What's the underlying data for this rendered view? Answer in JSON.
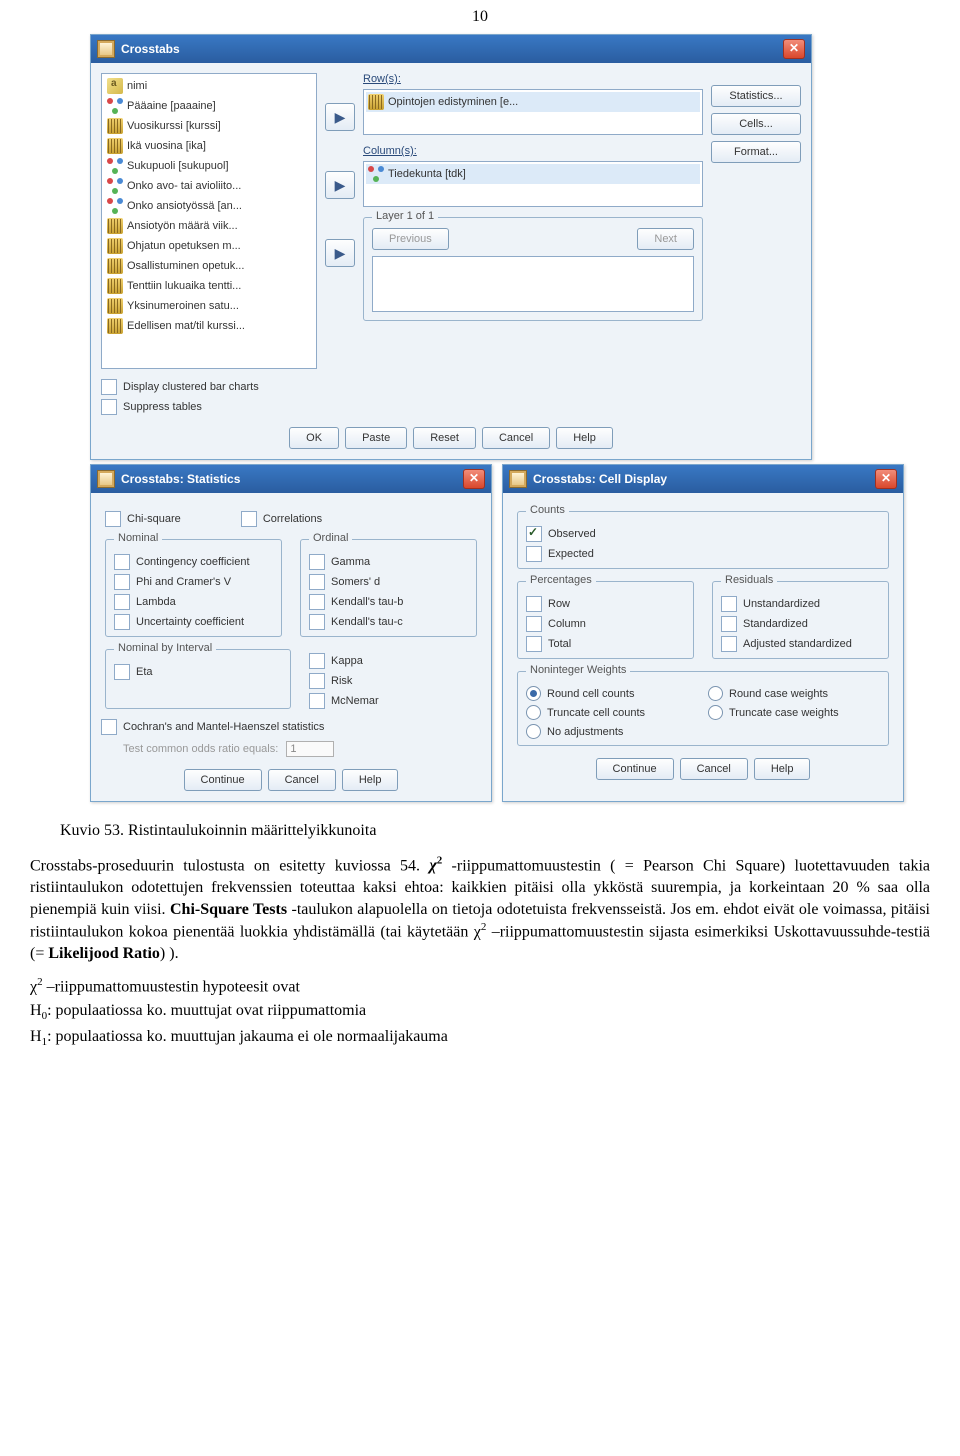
{
  "page_number": "10",
  "crosstabs": {
    "title": "Crosstabs",
    "vars": [
      {
        "icon": "str",
        "label": "nimi"
      },
      {
        "icon": "nom",
        "label": "Pääaine [paaaine]"
      },
      {
        "icon": "sca",
        "label": "Vuosikurssi [kurssi]"
      },
      {
        "icon": "sca",
        "label": "Ikä vuosina [ika]"
      },
      {
        "icon": "nom",
        "label": "Sukupuoli [sukupuol]"
      },
      {
        "icon": "nom",
        "label": "Onko avo- tai avioliito..."
      },
      {
        "icon": "nom",
        "label": "Onko ansiotyössä [an..."
      },
      {
        "icon": "sca",
        "label": "Ansiotyön määrä viik..."
      },
      {
        "icon": "sca",
        "label": "Ohjatun opetuksen m..."
      },
      {
        "icon": "sca",
        "label": "Osallistuminen opetuk..."
      },
      {
        "icon": "sca",
        "label": "Tenttiin lukuaika tentti..."
      },
      {
        "icon": "sca",
        "label": "Yksinumeroinen satu..."
      },
      {
        "icon": "sca",
        "label": "Edellisen mat/til kurssi..."
      }
    ],
    "rows_label": "Row(s):",
    "row_item": "Opintojen edistyminen [e...",
    "cols_label": "Column(s):",
    "col_item": "Tiedekunta [tdk]",
    "layer_label": "Layer 1 of 1",
    "previous": "Previous",
    "next": "Next",
    "statistics_btn": "Statistics...",
    "cells_btn": "Cells...",
    "format_btn": "Format...",
    "display_bar": "Display clustered bar charts",
    "suppress": "Suppress tables",
    "btns": {
      "ok": "OK",
      "paste": "Paste",
      "reset": "Reset",
      "cancel": "Cancel",
      "help": "Help"
    }
  },
  "stats": {
    "title": "Crosstabs: Statistics",
    "chi": "Chi-square",
    "corr": "Correlations",
    "nominal": {
      "label": "Nominal",
      "items": [
        "Contingency coefficient",
        "Phi and Cramer's V",
        "Lambda",
        "Uncertainty coefficient"
      ]
    },
    "ordinal": {
      "label": "Ordinal",
      "items": [
        "Gamma",
        "Somers' d",
        "Kendall's tau-b",
        "Kendall's tau-c"
      ]
    },
    "nom_int": {
      "label": "Nominal by Interval",
      "items": [
        "Eta"
      ]
    },
    "right": {
      "items": [
        "Kappa",
        "Risk",
        "McNemar"
      ]
    },
    "cochran": "Cochran's and Mantel-Haenszel statistics",
    "test_common": "Test common odds ratio equals:",
    "val": "1",
    "btns": {
      "cont": "Continue",
      "cancel": "Cancel",
      "help": "Help"
    }
  },
  "cells": {
    "title": "Crosstabs: Cell Display",
    "counts": {
      "label": "Counts",
      "observed": "Observed",
      "expected": "Expected"
    },
    "perc": {
      "label": "Percentages",
      "row": "Row",
      "col": "Column",
      "total": "Total"
    },
    "resid": {
      "label": "Residuals",
      "un": "Unstandardized",
      "st": "Standardized",
      "adj": "Adjusted standardized"
    },
    "nonint": {
      "label": "Noninteger Weights",
      "r": [
        "Round cell counts",
        "Truncate cell counts",
        "No adjustments"
      ],
      "r2": [
        "Round case weights",
        "Truncate case weights"
      ]
    },
    "btns": {
      "cont": "Continue",
      "cancel": "Cancel",
      "help": "Help"
    }
  },
  "caption": "Kuvio 53. Ristintaulukoinnin määrittelyikkunoita",
  "text": {
    "p1a": "Crosstabs-proseduurin tulostusta on esitetty kuviossa 54. ",
    "p1b": "-riippumattomuustestin ( = Pearson Chi Square) luotettavuuden takia ristiintaulukon odotettujen frekvenssien toteuttaa kaksi ehtoa: kaikkien pitäisi olla ykköstä suurempia, ja korkeintaan 20 % saa olla pienempiä kuin viisi. ",
    "p1c": "Chi-Square Tests",
    "p1d": " -taulukon alapuolella on tietoja odotetuista frekvensseistä. Jos em. ehdot eivät ole voimassa, pitäisi ristiintaulukon kokoa pienentää luokkia yhdistämällä (tai käytetään χ",
    "p1e": " –riippumattomuustestin sijasta esimerkiksi Uskottavuussuhde-testiä (= ",
    "p1f": "Likelijood Ratio",
    "p1g": ") ).",
    "h_line": "χ2 –riippumattomuustestin hypoteesit ovat",
    "h0": "H0: populaatiossa ko. muuttujat ovat riippumattomia",
    "h1": "H1: populaatiossa ko. muuttujan jakauma ei ole normaalijakauma"
  }
}
